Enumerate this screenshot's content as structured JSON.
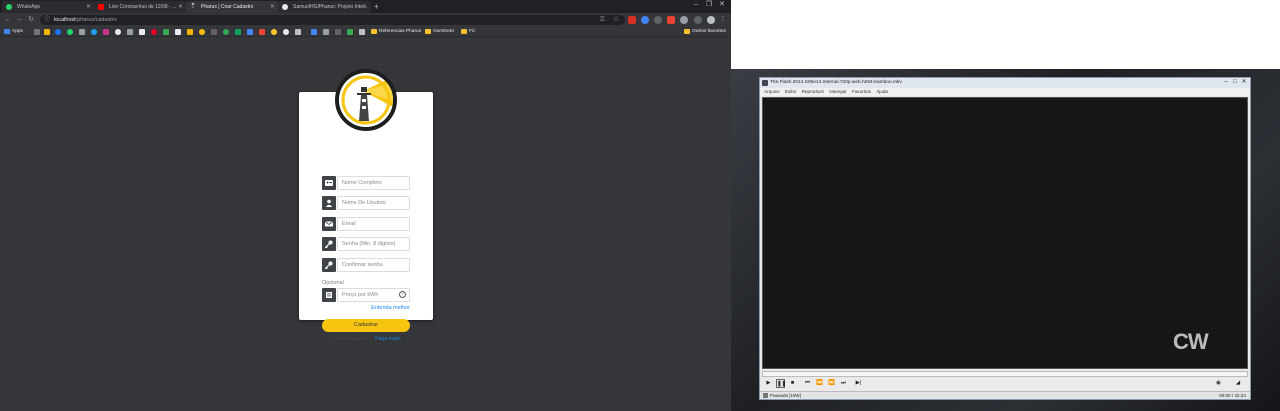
{
  "tabs": [
    {
      "title": "WhatsApp",
      "favicon_color": "#25d366"
    },
    {
      "title": "Live Coronavírus de 12/08 - ...",
      "favicon_color": "#ff0000"
    },
    {
      "title": "Pharus | Criar Cadastro",
      "favicon_color": "#e8eaed"
    },
    {
      "title": "SamuelHG/Pharus: Projeto Inte...",
      "favicon_color": "#e8eaed"
    }
  ],
  "address": {
    "host": "localhost",
    "path": "/pharus/cadastro"
  },
  "bookmarks": {
    "apps_label": "Apps",
    "folders": [
      "Referencias Pharus",
      "OurStreet",
      "FC"
    ],
    "other_label": "Outros favoritos"
  },
  "form": {
    "fields": [
      {
        "placeholder": "Nome Completo",
        "icon": "id-card-icon"
      },
      {
        "placeholder": "Nome De Usuário",
        "icon": "user-icon"
      },
      {
        "placeholder": "Email",
        "icon": "envelope-icon"
      },
      {
        "placeholder": "Senha (Min. 8 digitos)",
        "icon": "key-icon"
      },
      {
        "placeholder": "Confirmar senha",
        "icon": "key-icon"
      }
    ],
    "optional_label": "Opcional",
    "price_field": {
      "placeholder": "Preço por kWh",
      "icon": "bill-icon"
    },
    "help_glyph": "?",
    "learn_more": "Entenda melhor",
    "submit_label": "Cadastrar",
    "login_prompt": "Já tem cadastro?",
    "login_link": "Faça login",
    "accent_color": "#f7c510"
  },
  "player": {
    "title": "The.Flash.2014.S06e14.Internal.720p.web.h264-bamboo.mkv",
    "menu": [
      "Arquivo",
      "Exibir",
      "Reproduzir",
      "Navegar",
      "Favoritos",
      "Ajuda"
    ],
    "watermark": "CW",
    "status_left": "Pausado [H/W]",
    "status_right": "00:00 / 42:24"
  }
}
